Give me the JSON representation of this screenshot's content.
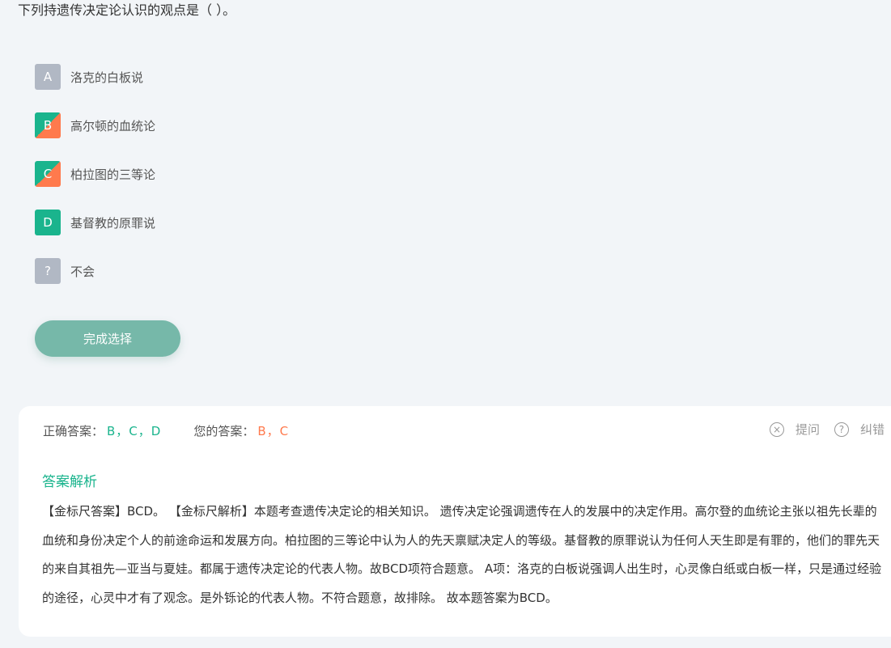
{
  "question": {
    "text": "下列持遗传决定论认识的观点是（ ）。"
  },
  "options": [
    {
      "letter": "A",
      "text": "洛克的白板说"
    },
    {
      "letter": "B",
      "text": "高尔顿的血统论"
    },
    {
      "letter": "C",
      "text": "柏拉图的三等论"
    },
    {
      "letter": "D",
      "text": "基督教的原罪说"
    },
    {
      "letter": "?",
      "text": "不会"
    }
  ],
  "finish_button": "完成选择",
  "result": {
    "correct_label": "正确答案：",
    "correct_value": "B，C，D",
    "user_label": "您的答案：",
    "user_value": "B，C",
    "ask_label": "提问",
    "report_label": "纠错"
  },
  "analysis": {
    "title": "答案解析",
    "body": "【金标尺答案】BCD。 【金标尺解析】本题考查遗传决定论的相关知识。 遗传决定论强调遗传在人的发展中的决定作用。高尔登的血统论主张以祖先长辈的血统和身份决定个人的前途命运和发展方向。柏拉图的三等论中认为人的先天禀赋决定人的等级。基督教的原罪说认为任何人天生即是有罪的，他们的罪先天的来自其祖先—亚当与夏娃。都属于遗传决定论的代表人物。故BCD项符合题意。 A项：洛克的白板说强调人出生时，心灵像白纸或白板一样，只是通过经验的途径，心灵中才有了观念。是外铄论的代表人物。不符合题意，故排除。 故本题答案为BCD。"
  },
  "colors": {
    "correct": "#1ab48d",
    "wrong": "#ff7a4d",
    "neutral": "#b1b8c4",
    "button": "#76b8a9"
  }
}
